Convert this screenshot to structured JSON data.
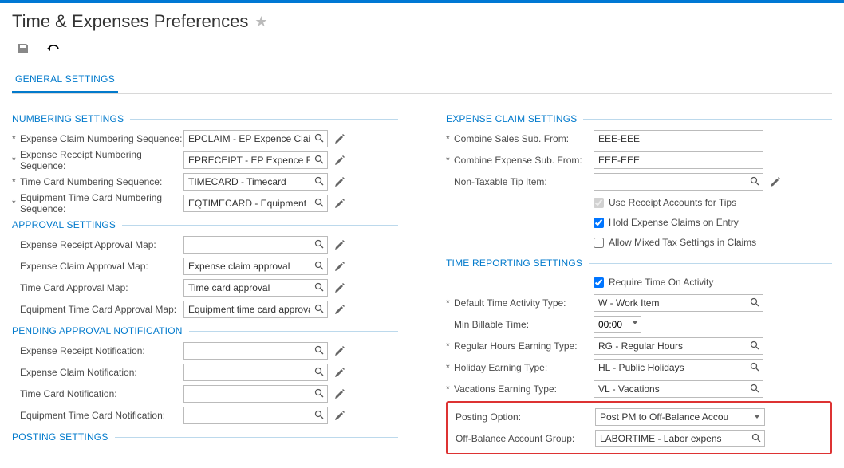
{
  "header": {
    "title": "Time & Expenses Preferences",
    "tab": "GENERAL SETTINGS"
  },
  "sections": {
    "numbering": "NUMBERING SETTINGS",
    "approval": "APPROVAL SETTINGS",
    "pending": "PENDING APPROVAL NOTIFICATION",
    "posting": "POSTING SETTINGS",
    "expense": "EXPENSE CLAIM SETTINGS",
    "time": "TIME REPORTING SETTINGS"
  },
  "numbering": {
    "expenseClaim": {
      "label": "Expense Claim Numbering Sequence:",
      "value": "EPCLAIM - EP Expence Clai"
    },
    "expenseReceipt": {
      "label": "Expense Receipt Numbering Sequence:",
      "value": "EPRECEIPT - EP Expence R"
    },
    "timeCard": {
      "label": "Time Card Numbering Sequence:",
      "value": "TIMECARD - Timecard"
    },
    "equipTimeCard": {
      "label": "Equipment Time Card Numbering Sequence:",
      "value": "EQTIMECARD - Equipment "
    }
  },
  "approval": {
    "receiptMap": {
      "label": "Expense Receipt Approval Map:",
      "value": ""
    },
    "claimMap": {
      "label": "Expense Claim Approval Map:",
      "value": "Expense claim approval"
    },
    "timeMap": {
      "label": "Time Card Approval Map:",
      "value": "Time card approval"
    },
    "equipMap": {
      "label": "Equipment Time Card Approval Map:",
      "value": "Equipment time card approva"
    }
  },
  "pending": {
    "receipt": {
      "label": "Expense Receipt Notification:",
      "value": ""
    },
    "claim": {
      "label": "Expense Claim Notification:",
      "value": ""
    },
    "time": {
      "label": "Time Card Notification:",
      "value": ""
    },
    "equip": {
      "label": "Equipment Time Card Notification:",
      "value": ""
    }
  },
  "expense": {
    "salesSub": {
      "label": "Combine Sales Sub. From:",
      "value": "EEE-EEE"
    },
    "expenseSub": {
      "label": "Combine Expense Sub. From:",
      "value": "EEE-EEE"
    },
    "nonTaxTip": {
      "label": "Non-Taxable Tip Item:",
      "value": ""
    },
    "useReceipt": {
      "label": "Use Receipt Accounts for Tips",
      "checked": true
    },
    "holdClaims": {
      "label": "Hold Expense Claims on Entry",
      "checked": true
    },
    "mixedTax": {
      "label": "Allow Mixed Tax Settings in Claims",
      "checked": false
    }
  },
  "time": {
    "requireActivity": {
      "label": "Require Time On Activity",
      "checked": true
    },
    "defaultType": {
      "label": "Default Time Activity Type:",
      "value": "W - Work Item"
    },
    "minBillable": {
      "label": "Min Billable Time:",
      "value": "00:00"
    },
    "regularHours": {
      "label": "Regular Hours Earning Type:",
      "value": "RG - Regular Hours"
    },
    "holiday": {
      "label": "Holiday Earning Type:",
      "value": "HL - Public Holidays"
    },
    "vacations": {
      "label": "Vacations Earning Type:",
      "value": "VL - Vacations"
    },
    "postingOption": {
      "label": "Posting Option:",
      "value": "Post PM to Off-Balance Accou"
    },
    "offBalance": {
      "label": "Off-Balance Account Group:",
      "value": "LABORTIME - Labor expens"
    }
  }
}
